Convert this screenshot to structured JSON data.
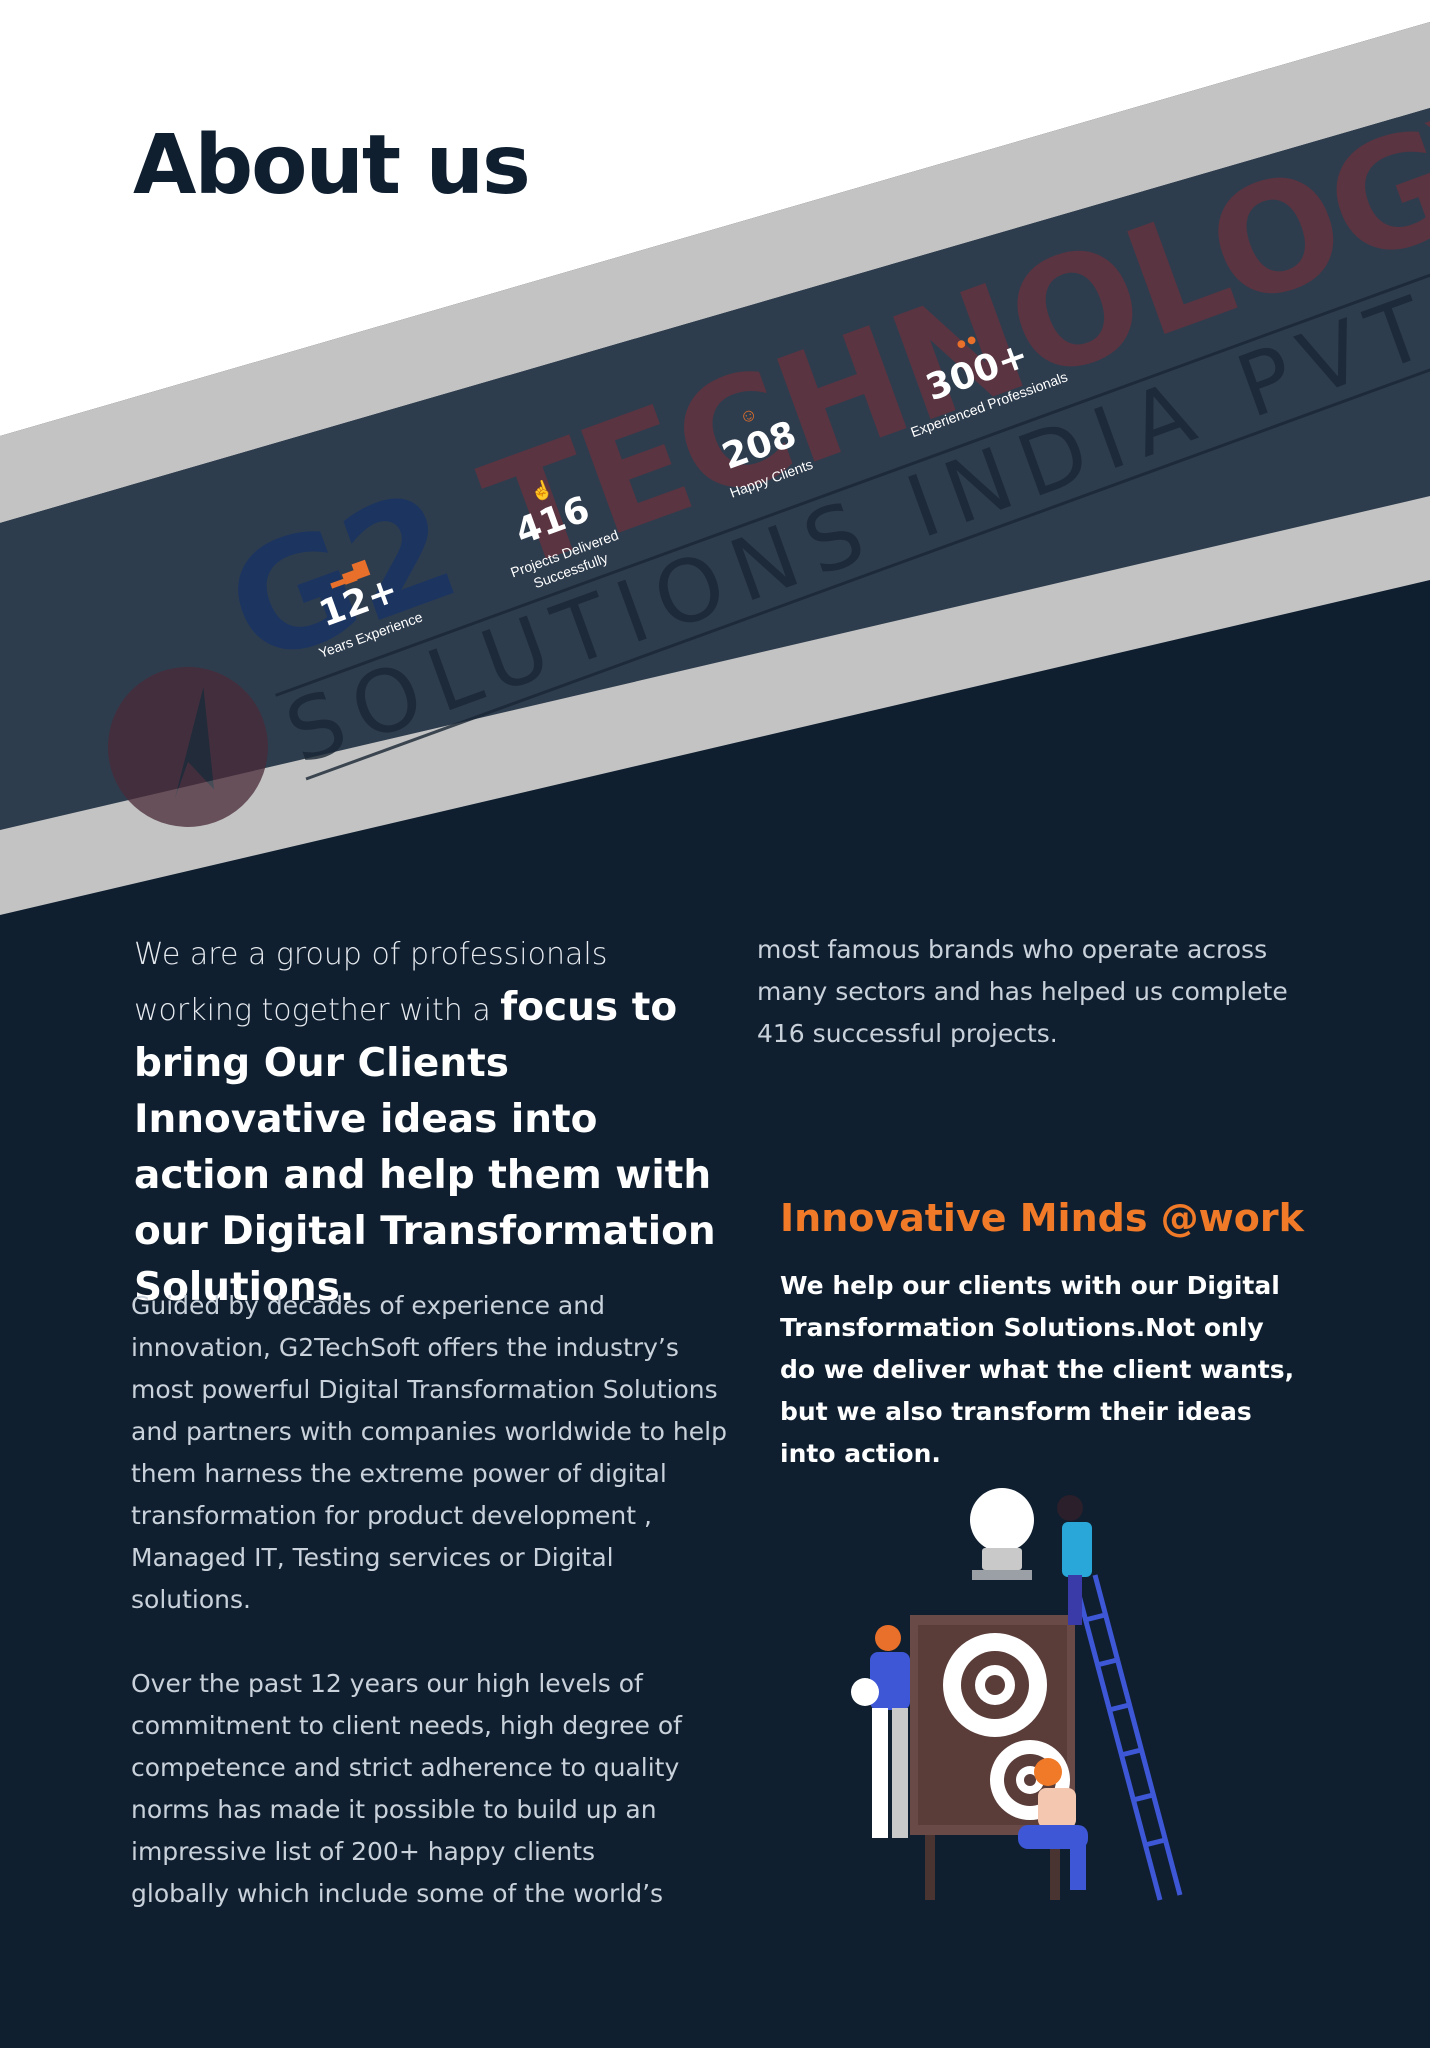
{
  "page": {
    "title": "About us"
  },
  "banner": {
    "watermark": {
      "brand_g2": "G2",
      "brand_word": "TECHNOLOGY",
      "subtitle": "SOLUTIONS INDIA PVT. LTD"
    },
    "stats": [
      {
        "icon": "signal-bars-icon",
        "value": "12+",
        "label": "Years Experience"
      },
      {
        "icon": "thumbs-up-icon",
        "value": "416",
        "label_line1": "Projects Delivered",
        "label_line2": "Successfully"
      },
      {
        "icon": "smiley-icon",
        "value": "208",
        "label": "Happy Clients"
      },
      {
        "icon": "users-icon",
        "value": "300+",
        "label": "Experienced Professionals"
      }
    ]
  },
  "intro": {
    "lead": "We are a group of professionals working together with a",
    "bold": "focus to bring Our Clients Innovative ideas into action and help them with our Digital Transformation Solutions."
  },
  "paragraphs": {
    "p1": "Guided by decades of experience and innovation, G2TechSoft offers the industry’s most powerful Digital Transformation Solutions and partners with companies worldwide to help them harness the extreme power of digital transformation for product development , Managed IT, Testing services or Digital solutions.",
    "p2": "Over the past 12 years our high levels of commitment to client needs, high degree of  competence and strict adherence to quality norms has made it possible to build up an impressive list of 200+ happy clients globally which include some of the world’s",
    "p3": "most famous brands who operate across many sectors and has helped us complete 416 successful projects."
  },
  "innovative": {
    "title": "Innovative Minds @work",
    "body": "We help our clients with our Digital Transformation Solutions.Not only do we deliver what the client wants, but we also transform their ideas into action."
  },
  "colors": {
    "navy": "#0f1f30",
    "band": "#2e3d4e",
    "stripe": "#c3c3c3",
    "accent": "#f07a28"
  }
}
